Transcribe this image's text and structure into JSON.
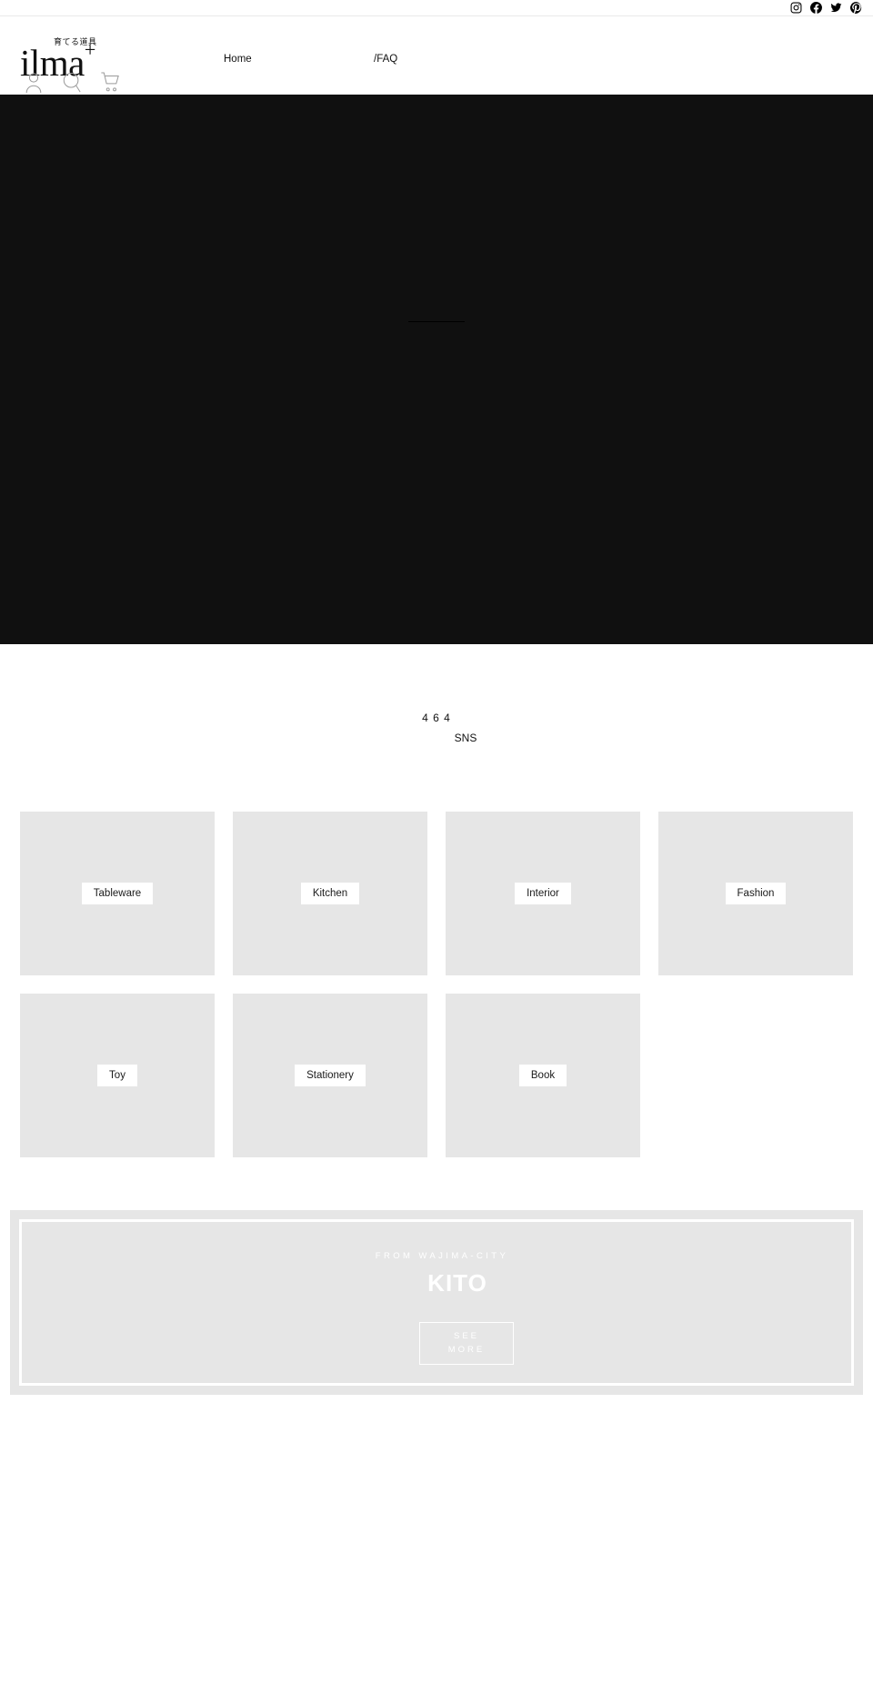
{
  "topbar": {
    "social": [
      {
        "name": "instagram-icon",
        "label": "Instagram"
      },
      {
        "name": "facebook-icon",
        "label": "Facebook"
      },
      {
        "name": "twitter-icon",
        "label": "Twitter"
      },
      {
        "name": "pinterest-icon",
        "label": "Pinterest"
      }
    ]
  },
  "header": {
    "brand": {
      "jp_tagline": "育てる道具",
      "name": "ilma",
      "plus": "+"
    },
    "util_icons": [
      {
        "name": "account-icon",
        "label": "Account"
      },
      {
        "name": "search-icon",
        "label": "Search"
      },
      {
        "name": "cart-icon",
        "label": "Cart"
      }
    ],
    "nav": [
      {
        "label": "Home"
      },
      {
        "label": "/FAQ"
      }
    ]
  },
  "hero": {
    "background_color": "#101010"
  },
  "intro": {
    "line1": "4 6  4",
    "line2": "SNS"
  },
  "categories": [
    {
      "label": "Tableware"
    },
    {
      "label": "Kitchen"
    },
    {
      "label": "Interior"
    },
    {
      "label": "Fashion"
    },
    {
      "label": "Toy"
    },
    {
      "label": "Stationery"
    },
    {
      "label": "Book"
    }
  ],
  "promo": {
    "kicker": "FROM WAJIMA-CITY",
    "title": "KITO",
    "button_line1": "SEE",
    "button_line2": "MORE"
  },
  "colors": {
    "hero_dark": "#101010",
    "tile_gray": "#e6e6e6",
    "text": "#111111",
    "white": "#ffffff"
  }
}
